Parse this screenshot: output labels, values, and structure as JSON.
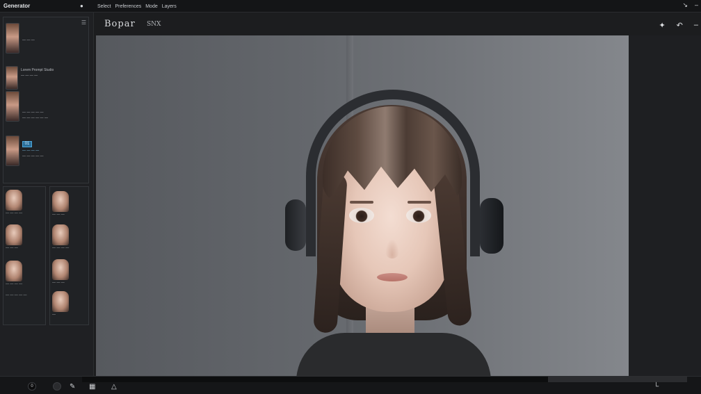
{
  "window": {
    "app_name": "Generator",
    "menu": [
      "Select",
      "Preferences",
      "Mode",
      "Layers"
    ],
    "controls": [
      "minimize-icon",
      "close-icon"
    ]
  },
  "document": {
    "title": "Bopar",
    "subtitle": "SNX"
  },
  "toolbar": {
    "icons": [
      "wand-icon",
      "undo-icon",
      "more-icon"
    ]
  },
  "left_panel": {
    "menu_icon": "hamburger-icon",
    "entries": [
      {
        "lines": [
          "— — —"
        ]
      },
      {
        "lines": [
          "Lorem Prompt Studio",
          "— — — —"
        ]
      },
      {
        "lines": [
          "— — — — —",
          "— — — — — —"
        ]
      },
      {
        "badge": "01",
        "lines": [
          "— — — —",
          "— — — — —"
        ]
      }
    ],
    "grid_a": [
      {
        "caption": "— — — —"
      },
      {
        "caption": "— — —"
      },
      {
        "caption": "— — — —"
      },
      {
        "caption": "— — — — —"
      }
    ],
    "grid_b": [
      {
        "caption": "— — —"
      },
      {
        "caption": "— — — —"
      },
      {
        "caption": "— — —"
      },
      {
        "caption": "—"
      }
    ]
  },
  "bottom_bar": {
    "icons": [
      "record-icon",
      "stop-icon",
      "pen-icon",
      "grid-icon",
      "flask-icon",
      "layout-icon"
    ]
  },
  "colors": {
    "accent": "#4ea6d8",
    "background": "#1c1d1f",
    "canvas": "#64676c"
  }
}
